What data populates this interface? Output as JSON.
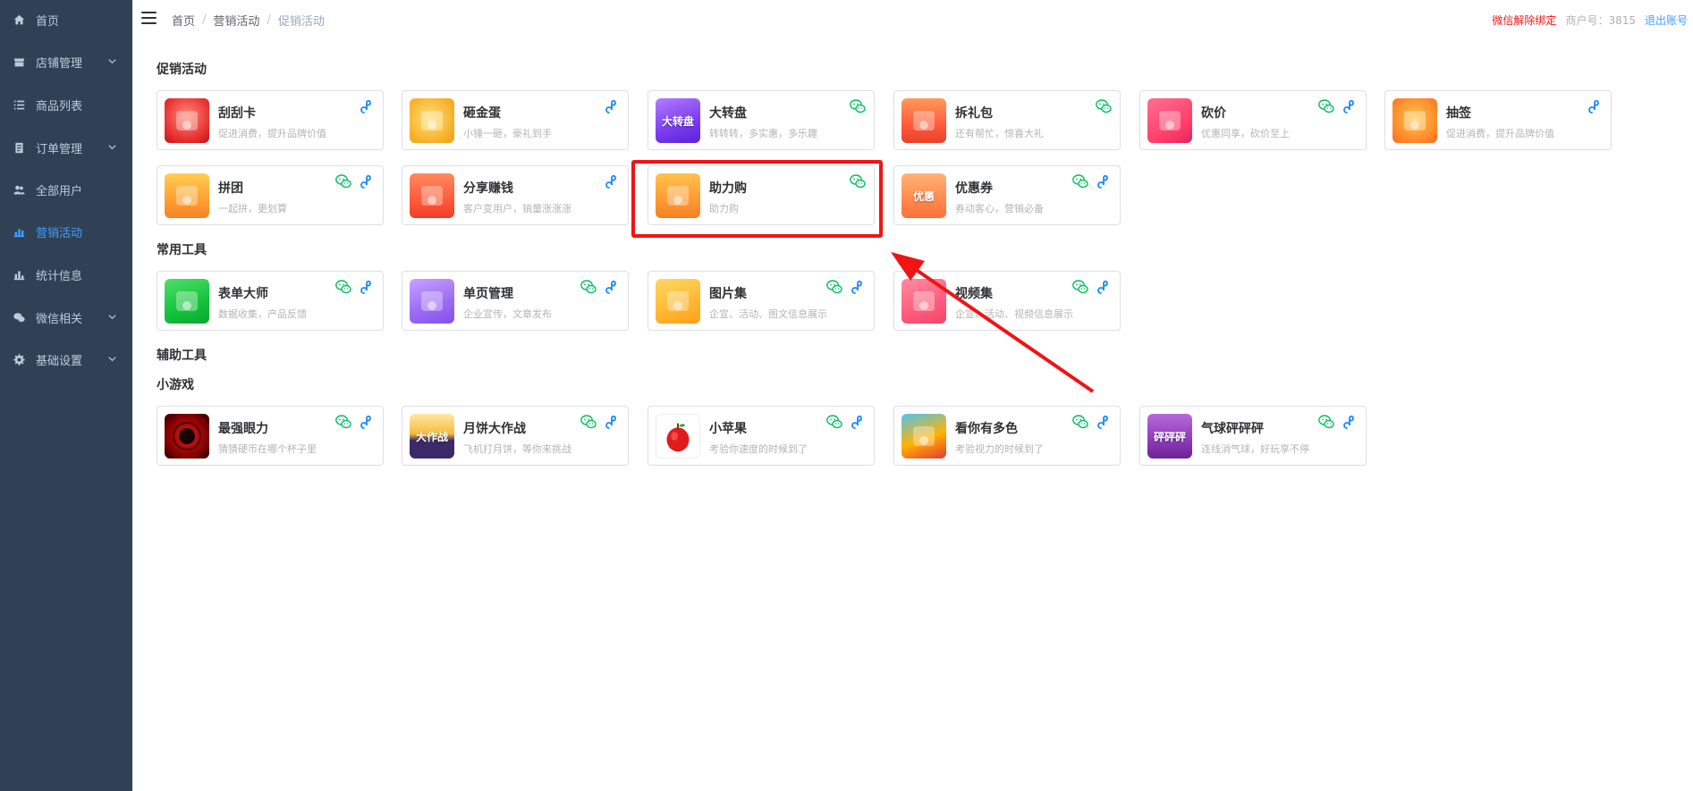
{
  "sidebar": {
    "items": [
      {
        "label": "首页",
        "icon": "home-icon",
        "active": false,
        "has_arrow": false
      },
      {
        "label": "店铺管理",
        "icon": "store-icon",
        "active": false,
        "has_arrow": true
      },
      {
        "label": "商品列表",
        "icon": "list-icon",
        "active": false,
        "has_arrow": false
      },
      {
        "label": "订单管理",
        "icon": "order-icon",
        "active": false,
        "has_arrow": true
      },
      {
        "label": "全部用户",
        "icon": "users-icon",
        "active": false,
        "has_arrow": false
      },
      {
        "label": "营销活动",
        "icon": "chart-icon",
        "active": true,
        "has_arrow": false
      },
      {
        "label": "统计信息",
        "icon": "stats-icon",
        "active": false,
        "has_arrow": false
      },
      {
        "label": "微信相关",
        "icon": "wechat-icon",
        "active": false,
        "has_arrow": true
      },
      {
        "label": "基础设置",
        "icon": "gear-icon",
        "active": false,
        "has_arrow": true
      }
    ]
  },
  "header": {
    "breadcrumb": [
      "首页",
      "营销活动",
      "促销活动"
    ],
    "unbind_wechat": "微信解除绑定",
    "merchant_id": "商户号：3815",
    "logout": "退出账号"
  },
  "sections": {
    "promo": "促销活动",
    "tools": "常用工具",
    "aux": "辅助工具",
    "games": "小游戏"
  },
  "promo_cards": [
    {
      "title": "刮刮卡",
      "desc": "促进消费，提升品牌价值",
      "wechat": false,
      "link": true,
      "thumb": "scratch-card-thumb"
    },
    {
      "title": "砸金蛋",
      "desc": "小锤一砸，豪礼到手",
      "wechat": false,
      "link": true,
      "thumb": "golden-egg-thumb"
    },
    {
      "title": "大转盘",
      "desc": "转转转，多实惠，多乐趣",
      "wechat": true,
      "link": false,
      "thumb": "wheel-thumb",
      "thumb_text": "大转盘"
    },
    {
      "title": "拆礼包",
      "desc": "还有帮忙，惊喜大礼",
      "wechat": true,
      "link": false,
      "thumb": "gift-pack-thumb"
    },
    {
      "title": "砍价",
      "desc": "优惠同享，砍价至上",
      "wechat": true,
      "link": true,
      "thumb": "bargain-thumb"
    },
    {
      "title": "抽签",
      "desc": "促进消费，提升品牌价值",
      "wechat": false,
      "link": true,
      "thumb": "lottery-thumb"
    },
    {
      "title": "拼团",
      "desc": "一起拼，更划算",
      "wechat": true,
      "link": true,
      "thumb": "group-buy-thumb"
    },
    {
      "title": "分享赚钱",
      "desc": "客户变用户，销量涨涨涨",
      "wechat": false,
      "link": true,
      "thumb": "share-earn-thumb"
    },
    {
      "title": "助力购",
      "desc": "助力购",
      "wechat": true,
      "link": false,
      "thumb": "assist-buy-thumb"
    },
    {
      "title": "优惠券",
      "desc": "券动客心，营销必备",
      "wechat": true,
      "link": true,
      "thumb": "coupon-thumb",
      "thumb_text": "优惠"
    }
  ],
  "tool_cards": [
    {
      "title": "表单大师",
      "desc": "数据收集，产品反馈",
      "wechat": true,
      "link": true,
      "thumb": "form-thumb"
    },
    {
      "title": "单页管理",
      "desc": "企业宣传，文章发布",
      "wechat": true,
      "link": true,
      "thumb": "page-thumb"
    },
    {
      "title": "图片集",
      "desc": "企宣、活动、图文信息展示",
      "wechat": true,
      "link": true,
      "thumb": "gallery-thumb"
    },
    {
      "title": "视频集",
      "desc": "企宣、活动、视频信息展示",
      "wechat": true,
      "link": true,
      "thumb": "video-thumb"
    }
  ],
  "game_cards": [
    {
      "title": "最强眼力",
      "desc": "猜猜硬币在哪个杯子里",
      "wechat": true,
      "link": true,
      "thumb": "eye-game-thumb"
    },
    {
      "title": "月饼大作战",
      "desc": "飞机打月饼，等你来挑战",
      "wechat": true,
      "link": true,
      "thumb": "mooncake-thumb",
      "thumb_text": "大作战"
    },
    {
      "title": "小苹果",
      "desc": "考验你速度的时候到了",
      "wechat": true,
      "link": true,
      "thumb": "apple-thumb"
    },
    {
      "title": "看你有多色",
      "desc": "考验视力的时候到了",
      "wechat": true,
      "link": true,
      "thumb": "color-game-thumb"
    },
    {
      "title": "气球砰砰砰",
      "desc": "连线消气球，好玩享不停",
      "wechat": true,
      "link": true,
      "thumb": "balloon-thumb",
      "thumb_text": "砰砰砰"
    }
  ],
  "colors": {
    "sidebar_bg": "#304156",
    "accent": "#409eff",
    "wechat_green": "#07c160",
    "highlight_red": "#f01414"
  }
}
